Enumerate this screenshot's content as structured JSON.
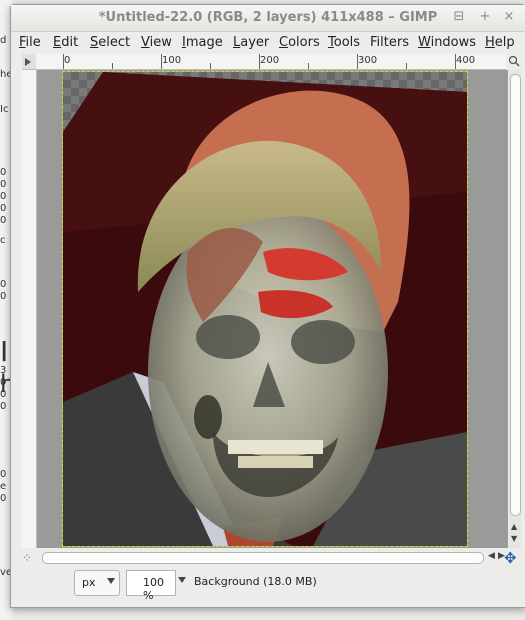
{
  "window": {
    "title": "*Untitled-22.0 (RGB, 2 layers) 411x488 – GIMP",
    "buttons": [
      "⊟",
      "+",
      "×"
    ]
  },
  "menu": [
    {
      "mnemonic": "F",
      "rest": "ile"
    },
    {
      "mnemonic": "E",
      "rest": "dit"
    },
    {
      "mnemonic": "S",
      "rest": "elect"
    },
    {
      "mnemonic": "V",
      "rest": "iew"
    },
    {
      "mnemonic": "I",
      "rest": "mage"
    },
    {
      "mnemonic": "L",
      "rest": "ayer"
    },
    {
      "mnemonic": "C",
      "rest": "olors"
    },
    {
      "mnemonic": "T",
      "rest": "ools"
    },
    {
      "mnemonic": "",
      "rest": "Filters"
    },
    {
      "mnemonic": "W",
      "rest": "indows"
    },
    {
      "mnemonic": "H",
      "rest": "elp"
    }
  ],
  "ruler": {
    "top_labels": [
      "0",
      "100",
      "200",
      "300",
      "400"
    ]
  },
  "status": {
    "unit": "px",
    "zoom": "100 %",
    "layer_info": "Background (18.0 MB)"
  },
  "icons": {
    "navigate": "navigate-icon",
    "quickmask": "quick-mask-icon",
    "zoom_toggle": "zoom-toggle-icon"
  },
  "background_fragments": [
    "d",
    "he",
    "Ic",
    "0",
    "0",
    "0",
    "0",
    "0",
    "c",
    "0",
    "0",
    "I",
    "h",
    "3",
    "0",
    "0",
    "0",
    "0",
    "e",
    "0",
    "ve"
  ]
}
